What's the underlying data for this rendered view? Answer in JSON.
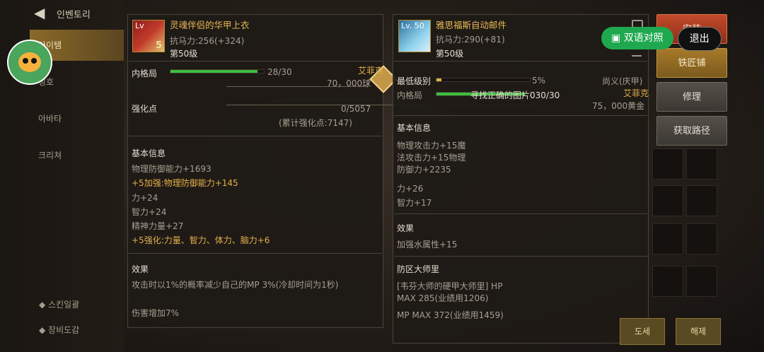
{
  "sidebar": {
    "title": "인벤토리",
    "items": [
      "아이템",
      "칭호",
      "아바타",
      "크리쳐"
    ],
    "bottom_items": [
      "스킨일괄",
      "장비도감"
    ]
  },
  "left_item": {
    "level_badge": "Lv",
    "name": "灵魂伴侣的华甲上衣",
    "resist": "抗马力:256(+324)",
    "level_req": "第50级",
    "icon_number": "5",
    "grade_label": "内格局",
    "grade_value": "28/30",
    "grade_fill_pct": 93,
    "price": "70，000球",
    "reinforce_label": "强化点",
    "reinforce_value": "0/5057",
    "reinforce_total": "(累计强化点:7147)",
    "basic_title": "基本信息",
    "basic_lines": [
      "物理防御能力+1693",
      "+5加强:物理防御能力+145",
      "力+24",
      "智力+24",
      "精神力量+27",
      "+5强化:力量、智力、体力、脑力+6"
    ],
    "effect_title": "效果",
    "effect_lines": [
      "攻击时以1%的概率减少自己的MP 3%(冷却时间为1秒)",
      "伤害增加7%"
    ]
  },
  "right_item": {
    "level_badge": "Lv. 50",
    "name": "雅思福斯自动邮件",
    "resist": "抗马力:290(+81)",
    "level_req": "第50级",
    "seller_tag": "艾菲克",
    "min_level_label": "最低级别",
    "min_level_value": "5%",
    "min_level_fill_pct": 5,
    "grade_label": "内格局",
    "grade_note": "寻找正确的图片030/30",
    "grade_fill_pct": 95,
    "seller_right": "尚义(庆甲)",
    "seller_right2": "艾菲克",
    "price": "75，000黄金",
    "basic_title": "基本信息",
    "basic_lines": [
      "物理攻击力+15魔",
      "法攻击力+15物理",
      "防御力+2235"
    ],
    "stat_lines": [
      "力+26",
      "智力+17"
    ],
    "effect_title": "效果",
    "effect_lines": [
      "加强水属性+15"
    ],
    "set_title": "防区大师里",
    "set_lines": [
      "[韦芬大师的硬甲大师里] HP",
      "MAX 285(业绩用1206)",
      "MP MAX 372(业绩用1459)"
    ]
  },
  "actions": {
    "install": "安装",
    "smithy": "铁匠铺",
    "repair": "修理",
    "obtain": "获取路径",
    "bilingual": "双语对照",
    "exit": "退出",
    "bottom_a": "도세",
    "bottom_b": "해제"
  },
  "colors": {
    "accent_gold": "#e3b04a",
    "bar_green": "#3fbf3f",
    "translate_green": "#1fa84f"
  }
}
